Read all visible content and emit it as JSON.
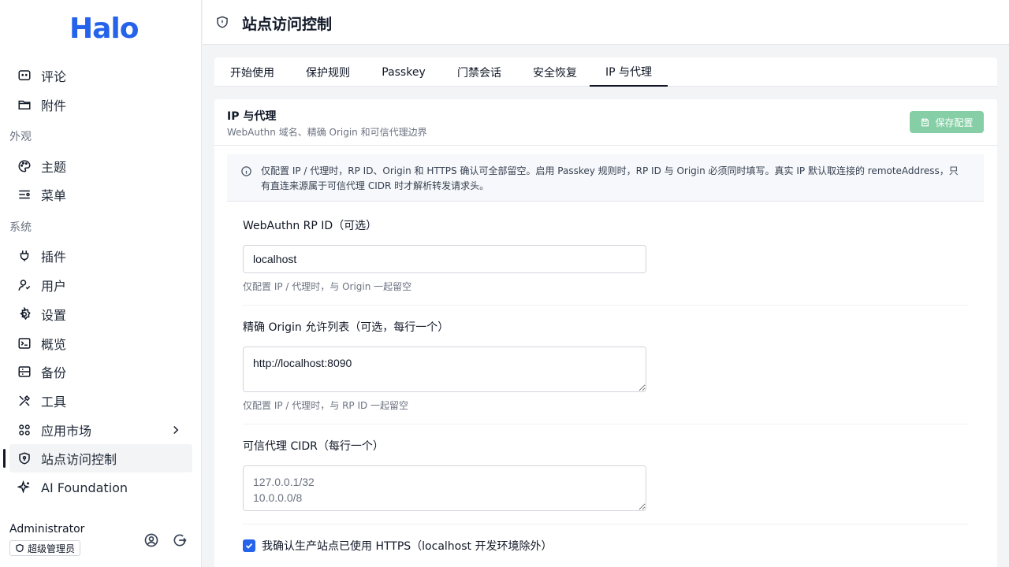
{
  "app": {
    "logo": "Halo"
  },
  "sidebar": {
    "items": [
      {
        "label": "评论",
        "icon": "comment-icon"
      },
      {
        "label": "附件",
        "icon": "folder-icon"
      }
    ],
    "group_appearance": "外观",
    "appearance_items": [
      {
        "label": "主题",
        "icon": "palette-icon"
      },
      {
        "label": "菜单",
        "icon": "menu-icon"
      }
    ],
    "group_system": "系统",
    "system_items": [
      {
        "label": "插件",
        "icon": "plug-icon"
      },
      {
        "label": "用户",
        "icon": "user-icon"
      },
      {
        "label": "设置",
        "icon": "gear-icon"
      },
      {
        "label": "概览",
        "icon": "terminal-icon"
      },
      {
        "label": "备份",
        "icon": "backup-icon"
      },
      {
        "label": "工具",
        "icon": "tools-icon"
      },
      {
        "label": "应用市场",
        "icon": "apps-icon"
      },
      {
        "label": "站点访问控制",
        "icon": "shield-icon"
      },
      {
        "label": "AI Foundation",
        "icon": "sparkle-icon"
      }
    ]
  },
  "profile": {
    "name": "Administrator",
    "role": "超级管理员"
  },
  "header": {
    "title": "站点访问控制"
  },
  "tabs": [
    "开始使用",
    "保护规则",
    "Passkey",
    "门禁会话",
    "安全恢复",
    "IP 与代理"
  ],
  "section": {
    "title": "IP 与代理",
    "subtitle": "WebAuthn 域名、精确 Origin 和可信代理边界",
    "save_label": "保存配置",
    "alert": "仅配置 IP / 代理时，RP ID、Origin 和 HTTPS 确认可全部留空。启用 Passkey 规则时，RP ID 与 Origin 必须同时填写。真实 IP 默认取连接的 remoteAddress，只有直连来源属于可信代理 CIDR 时才解析转发请求头。"
  },
  "fields": {
    "rpid": {
      "label": "WebAuthn RP ID（可选）",
      "value": "localhost",
      "help": "仅配置 IP / 代理时，与 Origin 一起留空"
    },
    "origin": {
      "label": "精确 Origin 允许列表（可选，每行一个）",
      "value": "http://localhost:8090",
      "help": "仅配置 IP / 代理时，与 RP ID 一起留空"
    },
    "cidr": {
      "label": "可信代理 CIDR（每行一个）",
      "placeholder": "127.0.0.1/32\n10.0.0.0/8"
    },
    "https_confirm": {
      "label": "我确认生产站点已使用 HTTPS（localhost 开发环境除外）",
      "checked": true
    }
  },
  "colors": {
    "brand": "#2563eb",
    "save_button": "#86cfa6"
  }
}
